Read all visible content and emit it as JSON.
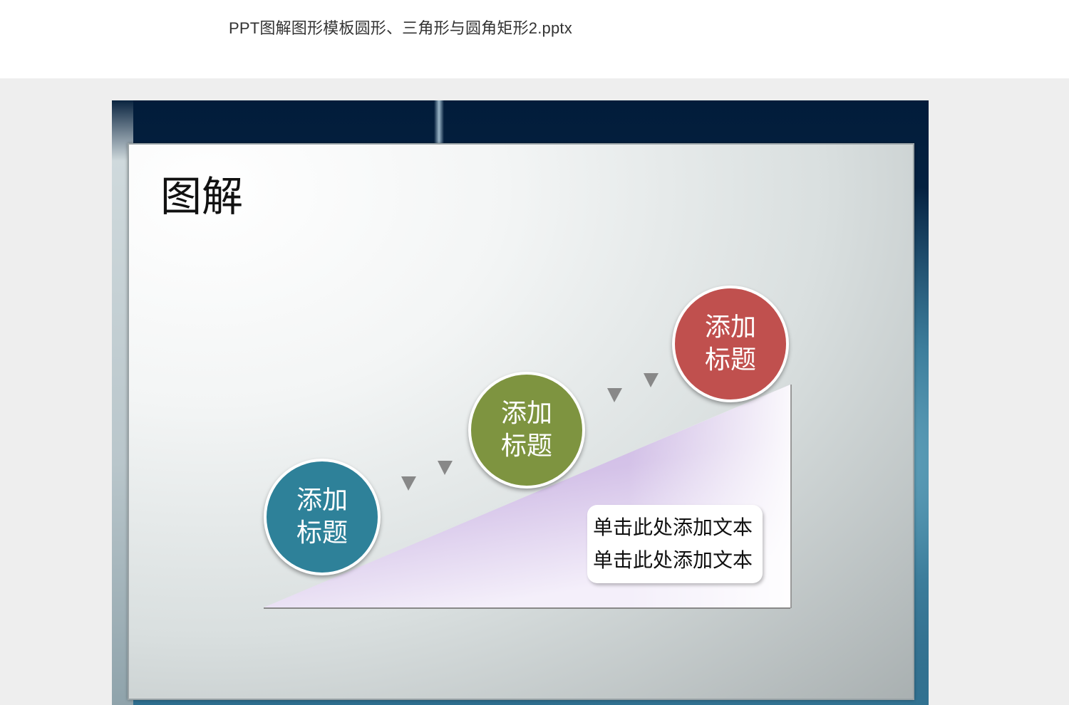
{
  "header": {
    "title": "PPT图解图形模板圆形、三角形与圆角矩形2.pptx"
  },
  "slide": {
    "title": "图解",
    "steps": [
      {
        "line1": "添加",
        "line2": "标题",
        "color": "#2e8199"
      },
      {
        "line1": "添加",
        "line2": "标题",
        "color": "#7e9440"
      },
      {
        "line1": "添加",
        "line2": "标题",
        "color": "#c0504e"
      }
    ],
    "text_box": {
      "line1": "单击此处添加文本",
      "line2": "单击此处添加文本"
    },
    "colors": {
      "triangle": "#c9b6df",
      "arrow": "#888888"
    }
  }
}
